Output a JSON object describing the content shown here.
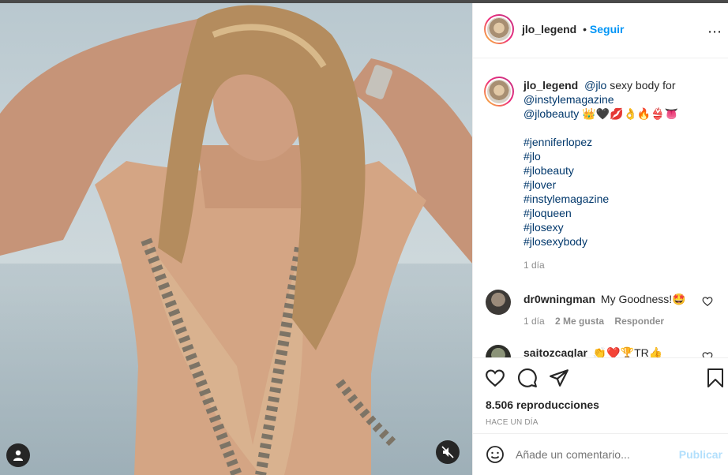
{
  "post": {
    "username": "jlo_legend",
    "follow_separator": "•",
    "follow_label": "Seguir",
    "more_icon": "more-dots-icon"
  },
  "caption": {
    "username": "jlo_legend",
    "mention1": "@jlo",
    "text1": " sexy body for ",
    "mention2": "@instylemagazine",
    "mention3": "@jlobeauty",
    "emojis": " 👑🖤💋👌🔥👙👅",
    "hashtags": [
      "#jenniferlopez",
      "#jlo",
      "#jlobeauty",
      "#jlover",
      "#instylemagazine",
      "#jloqueen",
      "#jlosexy",
      "#jlosexybody"
    ],
    "time": "1 día"
  },
  "comments": [
    {
      "username": "dr0wningman",
      "text": "My Goodness!🤩",
      "time": "1 día",
      "likes": "2 Me gusta",
      "reply": "Responder"
    },
    {
      "username": "saitozcaglar",
      "text": "👏❤️🏆TR👍"
    }
  ],
  "actions": {
    "views": "8.506 reproducciones",
    "date": "HACE UN DÍA"
  },
  "add_comment": {
    "placeholder": "Añade un comentario...",
    "publish": "Publicar"
  },
  "colors": {
    "accent": "#0095f6",
    "link": "#00376b",
    "muted": "#8e8e8e",
    "publish_disabled": "#b2dffc"
  }
}
